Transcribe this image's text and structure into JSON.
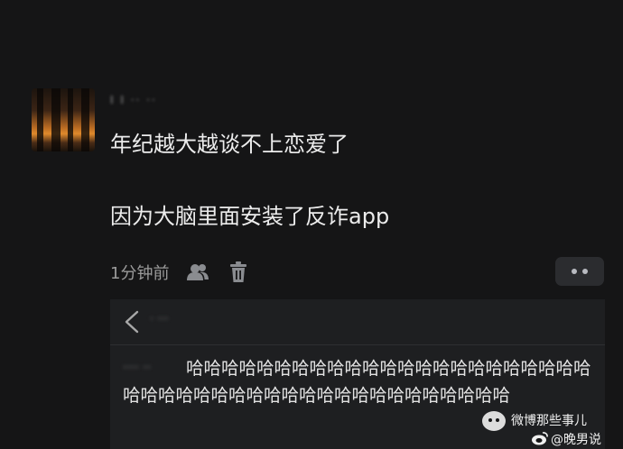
{
  "post": {
    "username": "I I ·· ··",
    "line1": "年纪越大越谈不上恋爱了",
    "line2": "因为大脑里面安装了反诈app",
    "time": "1分钟前"
  },
  "reply_panel": {
    "header_user": "· ···",
    "reply_name": "···· ··",
    "reply_text": "哈哈哈哈哈哈哈哈哈哈哈哈哈哈哈哈哈哈哈哈哈哈哈哈哈哈哈哈哈哈哈哈哈哈哈哈哈哈哈哈哈哈哈哈哈"
  },
  "watermark": {
    "line1": "微博那些事儿",
    "line2": "@晚男说"
  },
  "colors": {
    "background": "#151516",
    "panel": "#1e1f21",
    "more_button": "#2b2c2f",
    "muted_text": "#9b9b9b"
  },
  "icons": {
    "follow": "users-icon",
    "delete": "trash-icon",
    "more": "more-dots-icon",
    "back": "chevron-left-icon",
    "wechat": "wechat-icon",
    "weibo": "weibo-icon"
  }
}
